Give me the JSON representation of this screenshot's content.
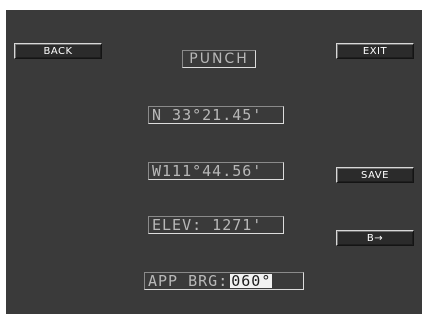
{
  "softkeys": {
    "back": "BACK",
    "exit": "EXIT",
    "save": "SAVE",
    "enter": "B→"
  },
  "title": "PUNCH",
  "fields": {
    "latitude": "N 33°21.45'",
    "longitude": "W111°44.56'",
    "elevation": "ELEV: 1271'",
    "approach_bearing_label": "APP BRG:",
    "approach_bearing_value": "060°"
  },
  "colors": {
    "screen_background": "#3a3a3a",
    "button_face": "#2b2b2b",
    "field_text": "#b8b8b8",
    "highlight_box": "#f2f2f2"
  }
}
